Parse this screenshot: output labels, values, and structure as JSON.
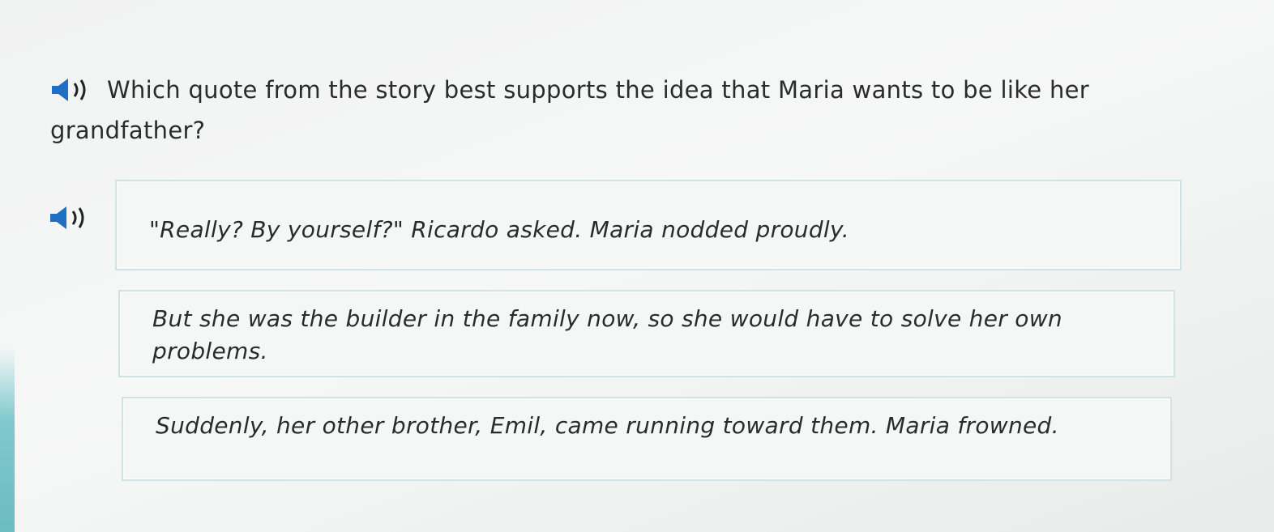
{
  "question": {
    "line1": "Which quote from the story best supports the idea that Maria wants to be like her",
    "line2": "grandfather?",
    "audio_icon": "speaker-icon"
  },
  "options": [
    {
      "text": "\"Really? By yourself?\" Ricardo asked. Maria nodded proudly.",
      "audio_icon": "speaker-icon"
    },
    {
      "text": "But she was the builder in the family now, so she would have to solve her own problems."
    },
    {
      "text": "Suddenly, her other brother, Emil, came running toward them. Maria frowned."
    }
  ],
  "colors": {
    "background": "#f2f3f3",
    "option_border": "#cfe3e4",
    "speaker_blue": "#1f6fc5",
    "accent_teal": "#7fc9cd"
  }
}
